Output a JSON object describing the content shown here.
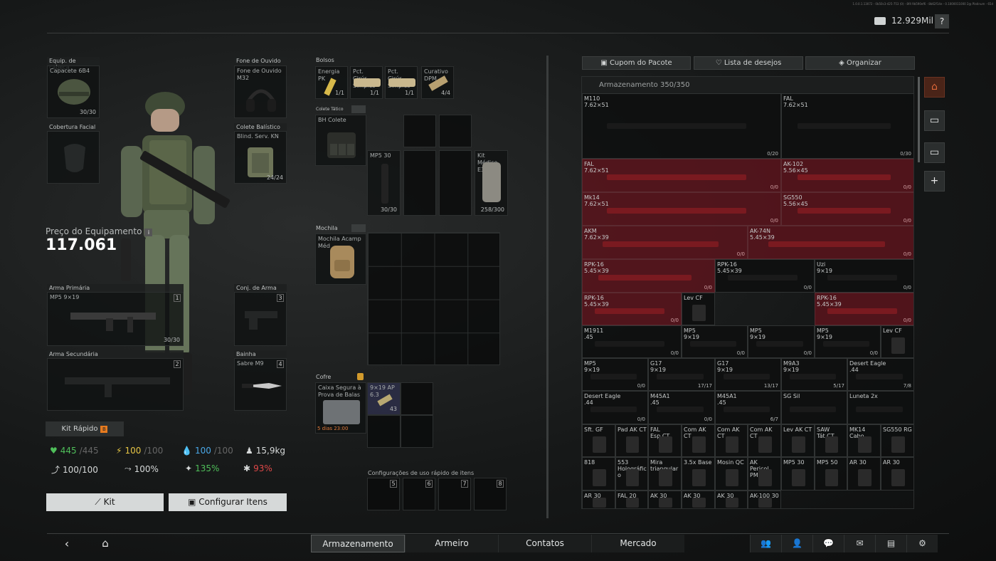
{
  "header": {
    "money": "12.929Mil",
    "help": "?",
    "build": "1.0.0.1.13072 - 0b50c3-425-753 (0) - 8f4 9b590ef6 - 8b62f14e - 0.1000011000 2@ Platinum - 65d"
  },
  "equipment": {
    "headwear": {
      "title": "Equip. de cabeça",
      "name": "Capacete 6B4",
      "count": "30/30"
    },
    "facecover": {
      "title": "Cobertura Facial"
    },
    "earpiece": {
      "title": "Fone de Ouvido",
      "name": "Fone de Ouvido M32"
    },
    "armor": {
      "title": "Colete Balístico",
      "name": "Blind. Serv. KN",
      "count": "24/24"
    },
    "primary": {
      "title": "Arma Primária",
      "name": "MP5 9×19",
      "num": "1",
      "count": "30/30"
    },
    "holster": {
      "title": "Conj. de Arma",
      "num": "3"
    },
    "secondary": {
      "title": "Arma Secundária",
      "num": "2"
    },
    "sheath": {
      "title": "Bainha",
      "name": "Sabre M9",
      "num": "4"
    }
  },
  "price": {
    "label": "Preço do Equipamento",
    "value": "117.061",
    "info": "i"
  },
  "kit_rapido": {
    "label": "Kit Rápido",
    "key": "B"
  },
  "stats": {
    "health": "445",
    "health_max": "/445",
    "energy": "100",
    "energy_max": "/100",
    "water": "100",
    "water_max": "/100",
    "weight": "15,9kg",
    "stat1": "100/100",
    "stat2": "100%",
    "stat3": "135%",
    "stat4": "93%"
  },
  "buttons": {
    "kit": "Kit",
    "configure": "Configurar Itens"
  },
  "pockets": {
    "title": "Bolsos",
    "items": [
      {
        "name": "Energia PK",
        "count": "1/1"
      },
      {
        "name": "Pct. Cirúr. Simples",
        "count": "1/1"
      },
      {
        "name": "Pct. Cirúr. Simples",
        "count": "1/1"
      },
      {
        "name": "Curativo DPM",
        "count": "4/4"
      }
    ]
  },
  "rig": {
    "title": "Colete Tático",
    "name": "BH Colete",
    "mag": {
      "name": "MP5 30",
      "count": "30/30"
    },
    "medkit": {
      "name": "Kit Médico E3",
      "count": "258/300"
    }
  },
  "backpack": {
    "title": "Mochila",
    "name": "Mochila Acamp Méd"
  },
  "secure": {
    "title": "Cofre",
    "name": "Caixa Segura à Prova de Balas",
    "timer": "5 dias 23:00",
    "ammo": {
      "name": "9×19 AP 6.3",
      "count": "43"
    }
  },
  "quick_slots": {
    "title": "Configurações de uso rápido de itens",
    "slots": [
      "5",
      "6",
      "7",
      "8"
    ]
  },
  "stash": {
    "buttons": [
      "Cupom do Pacote",
      "Lista de desejos",
      "Organizar"
    ],
    "title": "Armazenamento 350/350",
    "rows": [
      {
        "name": "M110\n7.62×51",
        "count": "0/20"
      },
      {
        "name": "FAL\n7.62×51",
        "count": "0/30"
      },
      {
        "name": "FAL\n7.62×51",
        "count": "0/0"
      },
      {
        "name": "AK-102\n5.56×45",
        "count": "0/0"
      },
      {
        "name": "Mk14\n7.62×51",
        "count": "0/0"
      },
      {
        "name": "SG550\n5.56×45",
        "count": "0/0"
      },
      {
        "name": "AKM\n7.62×39",
        "count": "0/0"
      },
      {
        "name": "AK-74N\n5.45×39",
        "count": "0/0"
      },
      {
        "name": "RPK-16\n5.45×39",
        "count": "0/0"
      },
      {
        "name": "RPK-16\n5.45×39",
        "count": "0/0"
      },
      {
        "name": "Uzi\n9×19",
        "count": "0/0"
      },
      {
        "name": "RPK-16\n5.45×39",
        "count": "0/0"
      },
      {
        "name": "Lev CF",
        "count": ""
      },
      {
        "name": "RPK-16\n5.45×39",
        "count": "0/0"
      },
      {
        "name": "M1911\n.45",
        "count": "0/0"
      },
      {
        "name": "MP5\n9×19",
        "count": "0/0"
      },
      {
        "name": "MP5\n9×19",
        "count": "0/0"
      },
      {
        "name": "MP5\n9×19",
        "count": "0/0"
      },
      {
        "name": "Lev CF",
        "count": ""
      },
      {
        "name": "MP5\n9×19",
        "count": "0/0"
      },
      {
        "name": "G17\n9×19",
        "count": "17/17"
      },
      {
        "name": "G17\n9×19",
        "count": "13/17"
      },
      {
        "name": "M9A3\n9×19",
        "count": "5/17"
      },
      {
        "name": "Desert Eagle\n.44",
        "count": "7/8"
      },
      {
        "name": "Desert Eagle\n.44",
        "count": "0/0"
      },
      {
        "name": "M45A1\n.45",
        "count": "0/0"
      },
      {
        "name": "M45A1\n.45",
        "count": "6/7"
      },
      {
        "name": "SG Sil",
        "count": ""
      },
      {
        "name": "Luneta 2x",
        "count": ""
      },
      {
        "name": "Sft. GF",
        "count": ""
      },
      {
        "name": "Pad AK CT",
        "count": ""
      },
      {
        "name": "FAL\nEsp CT",
        "count": ""
      },
      {
        "name": "Com AK\nCT",
        "count": ""
      },
      {
        "name": "Com AK\nCT",
        "count": ""
      },
      {
        "name": "Com AK\nCT",
        "count": ""
      },
      {
        "name": "Lev AK CT",
        "count": ""
      },
      {
        "name": "SAW\nTát CT",
        "count": ""
      },
      {
        "name": "MK14\nCabo",
        "count": ""
      },
      {
        "name": "SG550 RG",
        "count": ""
      },
      {
        "name": "818",
        "count": ""
      },
      {
        "name": "553\nHolográfic\no",
        "count": ""
      },
      {
        "name": "Mira\ntriangular",
        "count": ""
      },
      {
        "name": "3.5x Base",
        "count": ""
      },
      {
        "name": "Mosin QC",
        "count": ""
      },
      {
        "name": "AK\nPericol\nPM",
        "count": ""
      },
      {
        "name": "MP5 30",
        "count": ""
      },
      {
        "name": "MP5 50",
        "count": ""
      },
      {
        "name": "AR 30",
        "count": ""
      },
      {
        "name": "AR 30",
        "count": ""
      },
      {
        "name": "AR 30",
        "count": ""
      },
      {
        "name": "FAL 20",
        "count": ""
      },
      {
        "name": "AK 30",
        "count": ""
      },
      {
        "name": "AK 30",
        "count": ""
      },
      {
        "name": "AK 30",
        "count": ""
      },
      {
        "name": "AK-100 30",
        "count": ""
      }
    ]
  },
  "nav": {
    "tabs": [
      "Armazenamento",
      "Armeiro",
      "Contatos",
      "Mercado"
    ],
    "active": "Armazenamento"
  }
}
